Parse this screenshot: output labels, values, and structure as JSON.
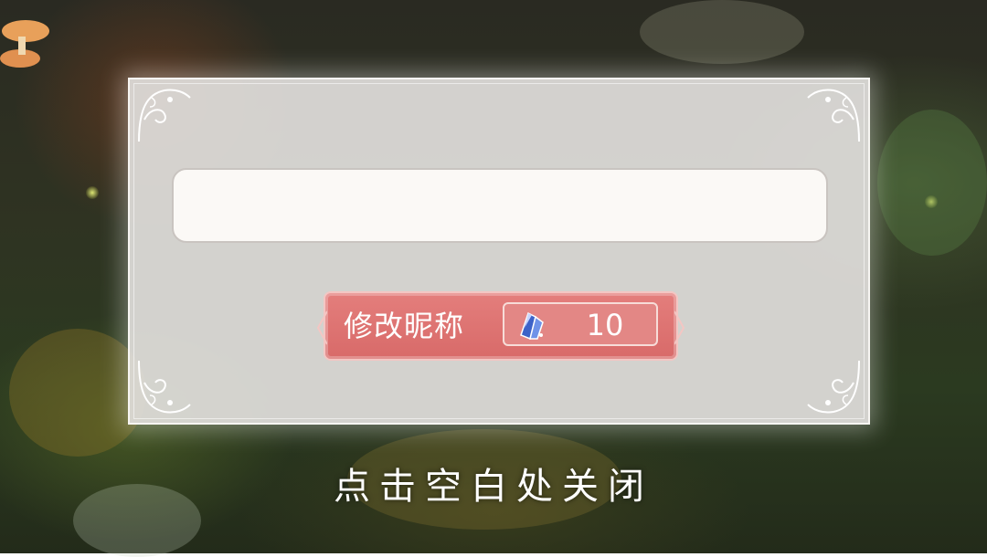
{
  "dialog": {
    "name_input": {
      "value": "",
      "placeholder": ""
    },
    "rename_button": {
      "label": "修改昵称",
      "cost_icon": "blue-crystal-icon",
      "cost_value": "10"
    }
  },
  "footer": {
    "close_hint": "点击空白处关闭"
  },
  "colors": {
    "button_accent": "#e07674",
    "dialog_bg": "#e2dfdd",
    "input_bg": "#fbf9f6"
  }
}
